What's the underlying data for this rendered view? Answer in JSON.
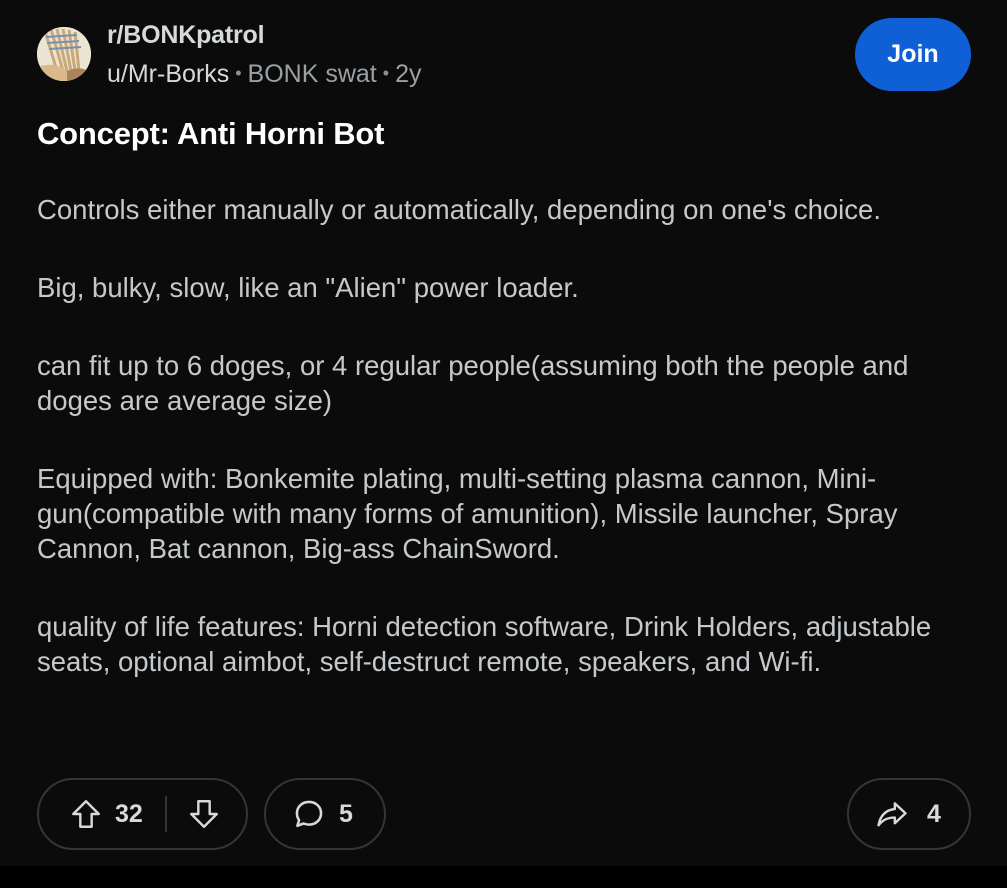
{
  "post": {
    "subreddit": "r/BONKpatrol",
    "author": "u/Mr-Borks",
    "flair": "BONK swat",
    "age": "2y",
    "separator": "•",
    "join_label": "Join",
    "title": "Concept: Anti Horni Bot",
    "paragraphs": [
      "Controls either manually or automatically, depending on one's choice.",
      "Big, bulky, slow, like an \"Alien\" power loader.",
      "can fit up to 6 doges, or 4 regular people(assuming both the people and doges are average size)",
      "Equipped with: Bonkemite plating, multi-setting plasma cannon, Mini-gun(compatible with many forms of amunition), Missile launcher, Spray Cannon, Bat cannon, Big-ass ChainSword.",
      "quality of life features: Horni detection software, Drink Holders, adjustable seats, optional aimbot, self-destruct remote, speakers, and Wi-fi."
    ]
  },
  "actions": {
    "upvotes": "32",
    "comments": "5",
    "shares": "4"
  },
  "icons": {
    "upvote": "arrow-up-icon",
    "downvote": "arrow-down-icon",
    "comment": "speech-bubble-icon",
    "share": "share-arrow-icon"
  },
  "colors": {
    "accent": "#0f5fd6",
    "background": "#0b0b0b",
    "border": "#343536"
  }
}
